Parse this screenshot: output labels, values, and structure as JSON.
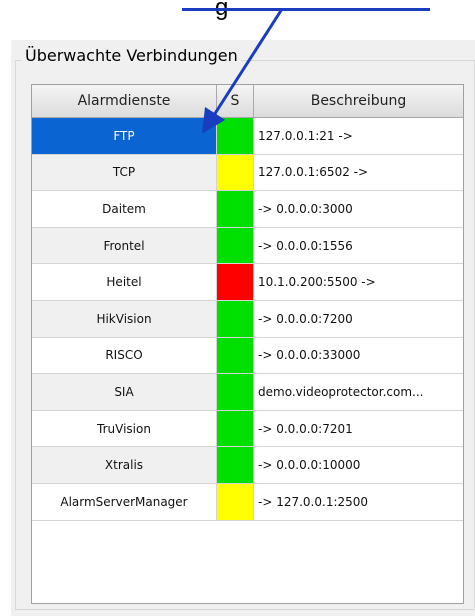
{
  "callout": {
    "label": "g"
  },
  "panel": {
    "title": "Überwachte Verbindungen"
  },
  "grid": {
    "headers": {
      "name": "Alarmdienste",
      "status": "S",
      "description": "Beschreibung"
    },
    "status_colors": {
      "green": "#00e000",
      "yellow": "#ffff00",
      "red": "#ff0000"
    },
    "rows": [
      {
        "name": "FTP",
        "status": "green",
        "description": "127.0.0.1:21 ->",
        "selected": true
      },
      {
        "name": "TCP",
        "status": "yellow",
        "description": "127.0.0.1:6502 ->"
      },
      {
        "name": "Daitem",
        "status": "green",
        "description": "-> 0.0.0.0:3000"
      },
      {
        "name": "Frontel",
        "status": "green",
        "description": "-> 0.0.0.0:1556"
      },
      {
        "name": "Heitel",
        "status": "red",
        "description": "10.1.0.200:5500 ->"
      },
      {
        "name": "HikVision",
        "status": "green",
        "description": "-> 0.0.0.0:7200"
      },
      {
        "name": "RISCO",
        "status": "green",
        "description": "-> 0.0.0.0:33000"
      },
      {
        "name": "SIA",
        "status": "green",
        "description": "demo.videoprotector.com..."
      },
      {
        "name": "TruVision",
        "status": "green",
        "description": "-> 0.0.0.0:7201"
      },
      {
        "name": "Xtralis",
        "status": "green",
        "description": "-> 0.0.0.0:10000"
      },
      {
        "name": "AlarmServerManager",
        "status": "yellow",
        "description": "-> 127.0.0.1:2500"
      }
    ]
  }
}
